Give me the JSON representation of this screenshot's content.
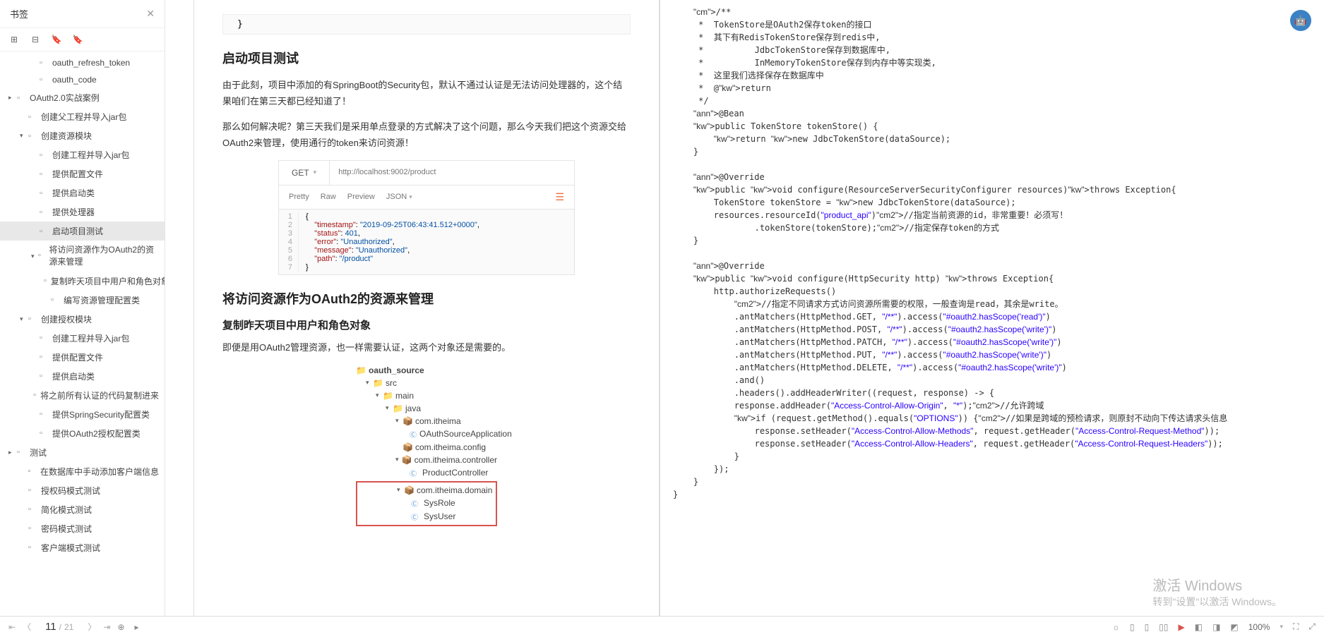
{
  "sidebar": {
    "title": "书签",
    "tree": [
      {
        "indent": 44,
        "arrow": "",
        "icon": "📄",
        "label": "oauth_refresh_token"
      },
      {
        "indent": 44,
        "arrow": "",
        "icon": "📄",
        "label": "oauth_code"
      },
      {
        "indent": 12,
        "arrow": "▸",
        "icon": "📄",
        "label": "OAuth2.0实战案例"
      },
      {
        "indent": 28,
        "arrow": "",
        "icon": "📄",
        "label": "创建父工程并导入jar包"
      },
      {
        "indent": 28,
        "arrow": "▾",
        "icon": "📄",
        "label": "创建资源模块"
      },
      {
        "indent": 44,
        "arrow": "",
        "icon": "📄",
        "label": "创建工程并导入jar包"
      },
      {
        "indent": 44,
        "arrow": "",
        "icon": "📄",
        "label": "提供配置文件"
      },
      {
        "indent": 44,
        "arrow": "",
        "icon": "📄",
        "label": "提供启动类"
      },
      {
        "indent": 44,
        "arrow": "",
        "icon": "📄",
        "label": "提供处理器"
      },
      {
        "indent": 44,
        "arrow": "",
        "icon": "📄",
        "label": "启动项目测试",
        "active": true
      },
      {
        "indent": 44,
        "arrow": "▾",
        "icon": "📄",
        "label": "将访问资源作为OAuth2的资源来管理",
        "wrap": true
      },
      {
        "indent": 60,
        "arrow": "",
        "icon": "📄",
        "label": "复制昨天项目中用户和角色对象"
      },
      {
        "indent": 60,
        "arrow": "",
        "icon": "📄",
        "label": "编写资源管理配置类"
      },
      {
        "indent": 28,
        "arrow": "▾",
        "icon": "📄",
        "label": "创建授权模块"
      },
      {
        "indent": 44,
        "arrow": "",
        "icon": "📄",
        "label": "创建工程并导入jar包"
      },
      {
        "indent": 44,
        "arrow": "",
        "icon": "📄",
        "label": "提供配置文件"
      },
      {
        "indent": 44,
        "arrow": "",
        "icon": "📄",
        "label": "提供启动类"
      },
      {
        "indent": 44,
        "arrow": "",
        "icon": "📄",
        "label": "将之前所有认证的代码复制进来"
      },
      {
        "indent": 44,
        "arrow": "",
        "icon": "📄",
        "label": "提供SpringSecurity配置类"
      },
      {
        "indent": 44,
        "arrow": "",
        "icon": "📄",
        "label": "提供OAuth2授权配置类"
      },
      {
        "indent": 12,
        "arrow": "▸",
        "icon": "📄",
        "label": "测试"
      },
      {
        "indent": 28,
        "arrow": "",
        "icon": "📄",
        "label": "在数据库中手动添加客户端信息"
      },
      {
        "indent": 28,
        "arrow": "",
        "icon": "📄",
        "label": "授权码模式测试"
      },
      {
        "indent": 28,
        "arrow": "",
        "icon": "📄",
        "label": "简化模式测试"
      },
      {
        "indent": 28,
        "arrow": "",
        "icon": "📄",
        "label": "密码模式测试"
      },
      {
        "indent": 28,
        "arrow": "",
        "icon": "📄",
        "label": "客户端模式测试"
      }
    ]
  },
  "doc": {
    "brace": "}",
    "h2_1": "启动项目测试",
    "p1": "由于此刻，项目中添加的有SpringBoot的Security包，默认不通过认证是无法访问处理器的，这个结果咱们在第三天都已经知道了！",
    "p2": "那么如何解决呢？第三天我们是采用单点登录的方式解决了这个问题，那么今天我们把这个资源交给OAuth2来管理，使用通行的token来访问资源！",
    "postman": {
      "method": "GET",
      "url": "http://localhost:9002/product",
      "tabs": [
        "Pretty",
        "Raw",
        "Preview",
        "JSON"
      ],
      "lines": [
        {
          "n": "1",
          "text": "{"
        },
        {
          "n": "2",
          "text": "    \"timestamp\": \"2019-09-25T06:43:41.512+0000\","
        },
        {
          "n": "3",
          "text": "    \"status\": 401,"
        },
        {
          "n": "4",
          "text": "    \"error\": \"Unauthorized\","
        },
        {
          "n": "5",
          "text": "    \"message\": \"Unauthorized\","
        },
        {
          "n": "6",
          "text": "    \"path\": \"/product\""
        },
        {
          "n": "7",
          "text": "}"
        }
      ]
    },
    "h2_2": "将访问资源作为OAuth2的资源来管理",
    "h3_1": "复制昨天项目中用户和角色对象",
    "p3": "即便是用OAuth2管理资源，也一样需要认证，这两个对象还是需要的。",
    "ftree": {
      "root": "oauth_source",
      "src": "src",
      "main": "main",
      "java": "java",
      "pkg1": "com.itheima",
      "app": "OAuthSourceApplication",
      "pkg2": "com.itheima.config",
      "pkg3": "com.itheima.controller",
      "ctrl": "ProductController",
      "pkg4": "com.itheima.domain",
      "role": "SysRole",
      "user": "SysUser"
    }
  },
  "code": "    /**\n     *  TokenStore是OAuth2保存token的接口\n     *  其下有RedisTokenStore保存到redis中,\n     *          JdbcTokenStore保存到数据库中,\n     *          InMemoryTokenStore保存到内存中等实现类,\n     *  这里我们选择保存在数据库中\n     *  @return\n     */\n    @Bean\n    public TokenStore tokenStore() {\n        return new JdbcTokenStore(dataSource);\n    }\n\n    @Override\n    public void configure(ResourceServerSecurityConfigurer resources)throws Exception{\n        TokenStore tokenStore = new JdbcTokenStore(dataSource);\n        resources.resourceId(\"product_api\")//指定当前资源的id，非常重要！必须写！\n                .tokenStore(tokenStore);//指定保存token的方式\n    }\n\n    @Override\n    public void configure(HttpSecurity http) throws Exception{\n        http.authorizeRequests()\n            //指定不同请求方式访问资源所需要的权限，一般查询是read，其余是write。\n            .antMatchers(HttpMethod.GET, \"/**\").access(\"#oauth2.hasScope('read')\")\n            .antMatchers(HttpMethod.POST, \"/**\").access(\"#oauth2.hasScope('write')\")\n            .antMatchers(HttpMethod.PATCH, \"/**\").access(\"#oauth2.hasScope('write')\")\n            .antMatchers(HttpMethod.PUT, \"/**\").access(\"#oauth2.hasScope('write')\")\n            .antMatchers(HttpMethod.DELETE, \"/**\").access(\"#oauth2.hasScope('write')\")\n            .and()\n            .headers().addHeaderWriter((request, response) -> {\n            response.addHeader(\"Access-Control-Allow-Origin\", \"*\");//允许跨域\n            if (request.getMethod().equals(\"OPTIONS\")) {//如果是跨域的预检请求，则原封不动向下传达请求头信息\n                response.setHeader(\"Access-Control-Allow-Methods\", request.getHeader(\"Access-Control-Request-Method\"));\n                response.setHeader(\"Access-Control-Allow-Headers\", request.getHeader(\"Access-Control-Request-Headers\"));\n            }\n        });\n    }\n}",
  "status": {
    "page_cur": "11",
    "page_total": "21",
    "zoom": "100%"
  },
  "watermark": {
    "line1": "激活 Windows",
    "line2": "转到\"设置\"以激活 Windows。"
  }
}
